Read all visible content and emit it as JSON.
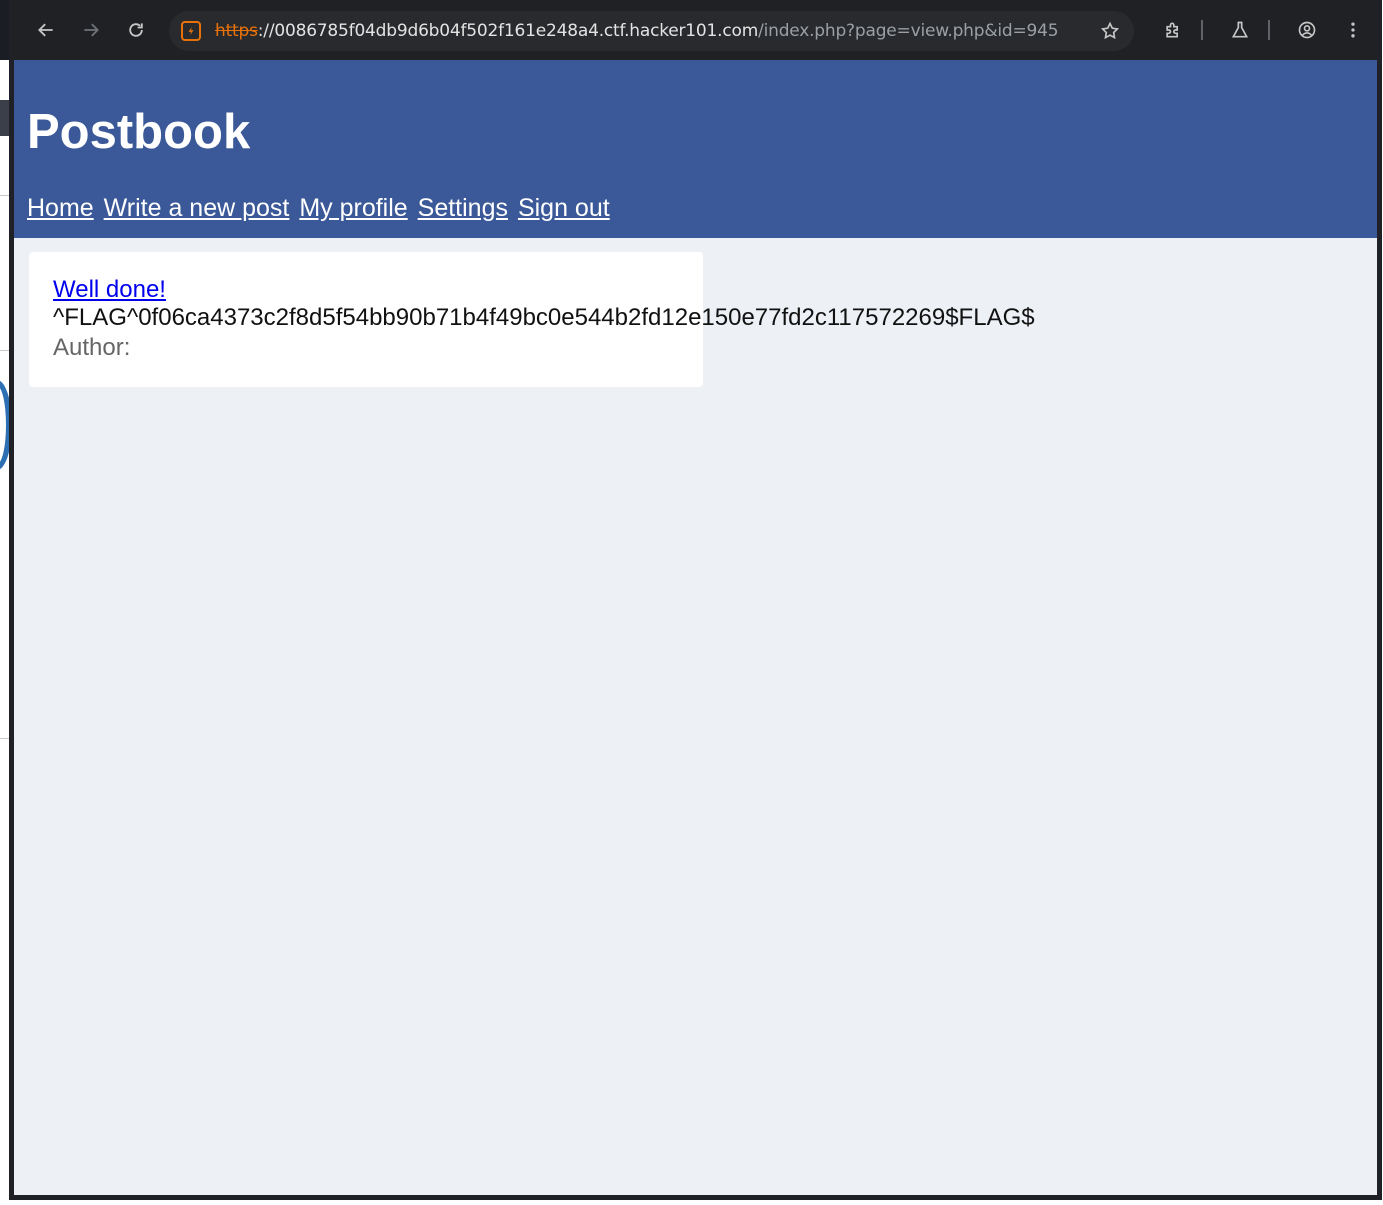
{
  "browser": {
    "url_scheme": "https",
    "url_host": "://0086785f04db9d6b04f502f161e248a4.ctf.hacker101.com",
    "url_path": "/index.php?page=view.php&id=945",
    "icons": [
      "back-icon",
      "forward-icon",
      "reload-icon",
      "site-info-icon",
      "bookmark-star-icon",
      "extensions-icon",
      "labs-icon",
      "profile-icon",
      "menu-icon"
    ]
  },
  "site": {
    "title": "Postbook",
    "header_color": "#3b5998",
    "background_color": "#edf0f5"
  },
  "nav": {
    "home": "Home",
    "write": "Write a new post",
    "profile": "My profile",
    "settings": "Settings",
    "signout": "Sign out"
  },
  "post": {
    "title": "Well done!",
    "body": "^FLAG^0f06ca4373c2f8d5f54bb90b71b4f49bc0e544b2fd12e150e77fd2c117572269$FLAG$",
    "author_label": "Author:"
  }
}
